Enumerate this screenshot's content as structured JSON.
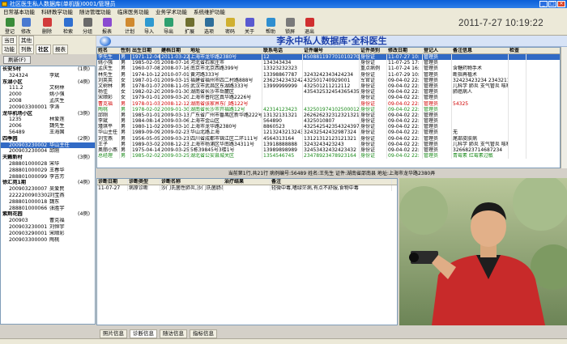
{
  "window": {
    "title": "社区医生私人数据库(单机版)0001/管理员"
  },
  "menu": [
    "日常基本功能",
    "科研教学功能",
    "随访管理功能",
    "临床医务功能",
    "业务学术功能",
    "系统维护功能"
  ],
  "toolbar": [
    "登记",
    "修改",
    "删除",
    "检索",
    "分组",
    "报表",
    "计划",
    "导入",
    "导出",
    "扩展",
    "选项",
    "密码",
    "关于",
    "帮助",
    "锁屏",
    "退出"
  ],
  "datetime": "2011-7-27  10:19:22",
  "left": {
    "tabs_top": [
      "当日",
      "其他"
    ],
    "tabs_mid": [
      "功能",
      "列数",
      "社区",
      "报表"
    ],
    "active_tab": "社区",
    "refresh": "刷新(F)",
    "tree": [
      {
        "a": "长安5村",
        "b": "",
        "c": "(1例)",
        "g": true
      },
      {
        "a": "324324",
        "b": "李斌",
        "c": ""
      },
      {
        "a": "东湖小区",
        "b": "",
        "c": "(4例)",
        "g": true
      },
      {
        "a": "111.2",
        "b": "文树林",
        "c": ""
      },
      {
        "a": "2000",
        "b": "姚小强",
        "c": ""
      },
      {
        "a": "2008",
        "b": "孟庆生",
        "c": ""
      },
      {
        "a": "200903300001",
        "b": "李涛",
        "c": ""
      },
      {
        "a": "龙华机场小区",
        "b": "",
        "c": "(3例)",
        "g": true
      },
      {
        "a": "1235",
        "b": "林爱莲",
        "c": ""
      },
      {
        "a": "2006",
        "b": "魏先生",
        "c": ""
      },
      {
        "a": "56489",
        "b": "王海国",
        "c": ""
      },
      {
        "a": "四季园",
        "b": "",
        "c": "(2例)",
        "g": true
      },
      {
        "a": "200903230002",
        "b": "华山主任",
        "c": "",
        "s": true
      },
      {
        "a": "200903230004",
        "b": "邱刚",
        "c": ""
      },
      {
        "a": "天籁新村",
        "b": "",
        "c": "(3例)",
        "g": true
      },
      {
        "a": "288801000028",
        "b": "宋华",
        "c": ""
      },
      {
        "a": "288801000029",
        "b": "王春华",
        "c": ""
      },
      {
        "a": "288801000099",
        "b": "李吉芳",
        "c": ""
      },
      {
        "a": "徐汇苑1期",
        "b": "",
        "c": "(4例)",
        "g": true
      },
      {
        "a": "200903230007",
        "b": "吴爱民",
        "c": ""
      },
      {
        "a": "22222009033023001",
        "b": "刘宝燕",
        "c": ""
      },
      {
        "a": "288801000018",
        "b": "魏东",
        "c": ""
      },
      {
        "a": "288801000066",
        "b": "张胜宇",
        "c": ""
      },
      {
        "a": "紫荆花园",
        "b": "",
        "c": "(4例)",
        "g": true
      },
      {
        "a": "200903",
        "b": "曹克福",
        "c": ""
      },
      {
        "a": "200903230001",
        "b": "刘恒宇",
        "c": ""
      },
      {
        "a": "200903290001",
        "b": "宋顺彩",
        "c": ""
      },
      {
        "a": "200903300000",
        "b": "陶桃",
        "c": ""
      }
    ]
  },
  "header": {
    "title": "李永中私人数据库·全科医生"
  },
  "grid": {
    "columns": [
      "姓名",
      "性别",
      "出生日期",
      "建档日期",
      "地址",
      "联系电话",
      "证件编号",
      "证件类别",
      "修改日期",
      "登记人",
      "备注信息",
      "检查"
    ],
    "rows": [
      [
        "李先生",
        "男",
        "1971-12-04",
        "2011-03-22",
        "上海市龙华路2380号",
        "12",
        "450881197701010270",
        "身份证",
        "11-07-27 10:",
        "管理员",
        "",
        ""
      ],
      [
        "姚小强",
        "男",
        "1985-02-05",
        "2008-07-16",
        "河北省石家庄市",
        "134343434",
        "",
        "身份证",
        "11-07-25 17:",
        "管理员",
        "",
        ""
      ],
      [
        "孟庆生",
        "男",
        "1960-07-08",
        "2008-07-16",
        "南京市北京西路399号",
        "13323232323",
        "",
        "重点病例",
        "11-07-24 16:",
        "管理员",
        "含糖药物手术",
        ""
      ],
      [
        "林先生",
        "男",
        "1974-10-12",
        "2010-07-01",
        "黄河路333号",
        "13398867787",
        "3243242343424234",
        "身份证",
        "11-07-29 10:",
        "管理员",
        "断指再植术",
        ""
      ],
      [
        "刘英英",
        "女",
        "1987-01-01",
        "2009-03-15",
        "福建省福州市四二村路888号",
        "23623423432423",
        "432501740929001",
        "军官证",
        "09-04-02 22:",
        "管理员",
        "32423423234  2343211  4311",
        ""
      ],
      [
        "文树林",
        "男",
        "1978-01-07",
        "2008-11-05",
        "武汉市武昌区东湖路333号",
        "13999999999",
        "432501211212112",
        "身份证",
        "09-04-02 22:",
        "管理员",
        "儿科学 肺炎 支气管炎 咳嗽",
        ""
      ],
      [
        "杨佳",
        "女",
        "1982-02-20",
        "2009-01-30",
        "湖南省长沙市岳麓区",
        "",
        "435432532454365435",
        "身份证",
        "09-04-02 22:",
        "管理员",
        "肺癌病人",
        ""
      ],
      [
        "宋顺彩",
        "女",
        "1979-01-01",
        "2009-03-20",
        "上海市普陀区真华路2226号",
        "",
        "",
        "身份证",
        "09-04-02 22:",
        "管理员",
        "",
        ""
      ],
      [
        "曹克福",
        "男",
        "1978-01-03",
        "2008-12-12",
        "湖南省张家界东门路122号",
        "",
        "",
        "身份证",
        "09-04-02 22:",
        "管理员",
        "54325",
        ""
      ],
      [
        "陶桃",
        "男",
        "1978-02-02",
        "2009-01-30",
        "湖南省长沙市开福路12号",
        "42314123423",
        "432501974102500012",
        "身份证",
        "09-04-02 22:",
        "管理员",
        "",
        ""
      ],
      [
        "邱刚",
        "男",
        "1985-01-01",
        "2009-03-13",
        "广东省广州市番禺区新华路222号",
        "13132131321",
        "2626262323123213213",
        "身份证",
        "09-04-02 22:",
        "管理员",
        "",
        ""
      ],
      [
        "李斌",
        "男",
        "1984-08-14",
        "2009-03-06",
        "上海市金山区",
        "564890",
        "4325010807",
        "身份证",
        "09-04-02 22:",
        "管理员",
        "",
        ""
      ],
      [
        "瑾琪平",
        "男",
        "1980-11-02",
        "2009-03-10",
        "上海市龙华路2380号",
        "8860523",
        "4325425423543243976",
        "身份证",
        "09-04-02 22:",
        "管理员",
        "",
        ""
      ],
      [
        "华山主任",
        "男",
        "1989-09-09",
        "2009-02-23",
        "华山北路上海",
        "1213243213243",
        "32432542432987324",
        "身份证",
        "09-04-02 22:",
        "管理员",
        "无",
        ""
      ],
      [
        "刘宝燕",
        "男",
        "1956-05-05",
        "2009-03-23",
        "四川省成都市锦江区二环111号",
        "4564313164",
        "13121312123121321",
        "身份证",
        "09-04-02 22:",
        "管理员",
        "尾部皮肤病",
        "",
        ""
      ],
      [
        "王子",
        "男",
        "1989-03-02",
        "2008-12-23",
        "上海市杨浦区华南路34311号",
        "13918888888",
        "3243243423243",
        "身份证",
        "09-04-02 22:",
        "管理员",
        "儿科学 肺炎 支气管炎 咳嗽",
        ""
      ],
      [
        "奥丽小燕",
        "男",
        "1975-04-14",
        "2009-03-25",
        "5栋39845号3楼1号",
        "13989898989",
        "32453432432423432",
        "身份证",
        "09-04-02 22:",
        "管理员",
        "3266823714687234",
        ""
      ],
      [
        "总经理",
        "男",
        "1985-02-02",
        "2009-03-25",
        "湖北省公安县城关区",
        "1354546745",
        "23478923478923164",
        "身份证",
        "09-04-02 22:",
        "管理员",
        "青霉素 红霉素过敏",
        ""
      ]
    ]
  },
  "status_line": "当前第1行,共21行  病例编号:56489  姓名:王先生  证件:湖南省邵南县  地址:上海市龙华路2380弄",
  "diagnosis": {
    "columns": [
      "诊断日期",
      "诊断类型",
      "诊断名称",
      "治疗结果",
      "备注"
    ],
    "rows": [
      [
        "11-07-27",
        "病原诊断",
        "沙门氏菌性肺炎,沙门氏菌肠炎",
        "",
        "轻微中毒,嗜绿茫病,有点不舒服,食物中毒"
      ]
    ]
  },
  "bottom_tabs": [
    "照片信息",
    "诊断信息",
    "随访信息",
    "指标信息"
  ],
  "active_bottom_tab": "诊断信息",
  "colors": {
    "accent": "#316ac5",
    "title": "#1c3fa8",
    "red_row": "#d00000",
    "green_row": "#1a8a1a"
  }
}
